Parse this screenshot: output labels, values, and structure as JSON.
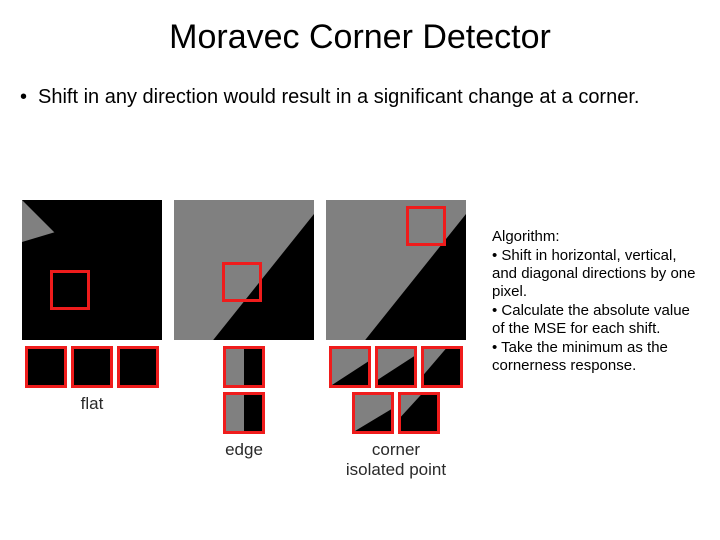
{
  "title": "Moravec Corner Detector",
  "bullet": "Shift in any direction would result in a significant change at a corner.",
  "panels": {
    "flat": {
      "label": "flat"
    },
    "edge": {
      "label": "edge"
    },
    "corner": {
      "label_line1": "corner",
      "label_line2": "isolated point"
    }
  },
  "algorithm": {
    "heading": "Algorithm:",
    "step1": "Shift in horizontal, vertical, and diagonal directions by one pixel.",
    "step2": "Calculate the absolute value of the MSE for each shift.",
    "step3": "Take the minimum as the cornerness response."
  }
}
